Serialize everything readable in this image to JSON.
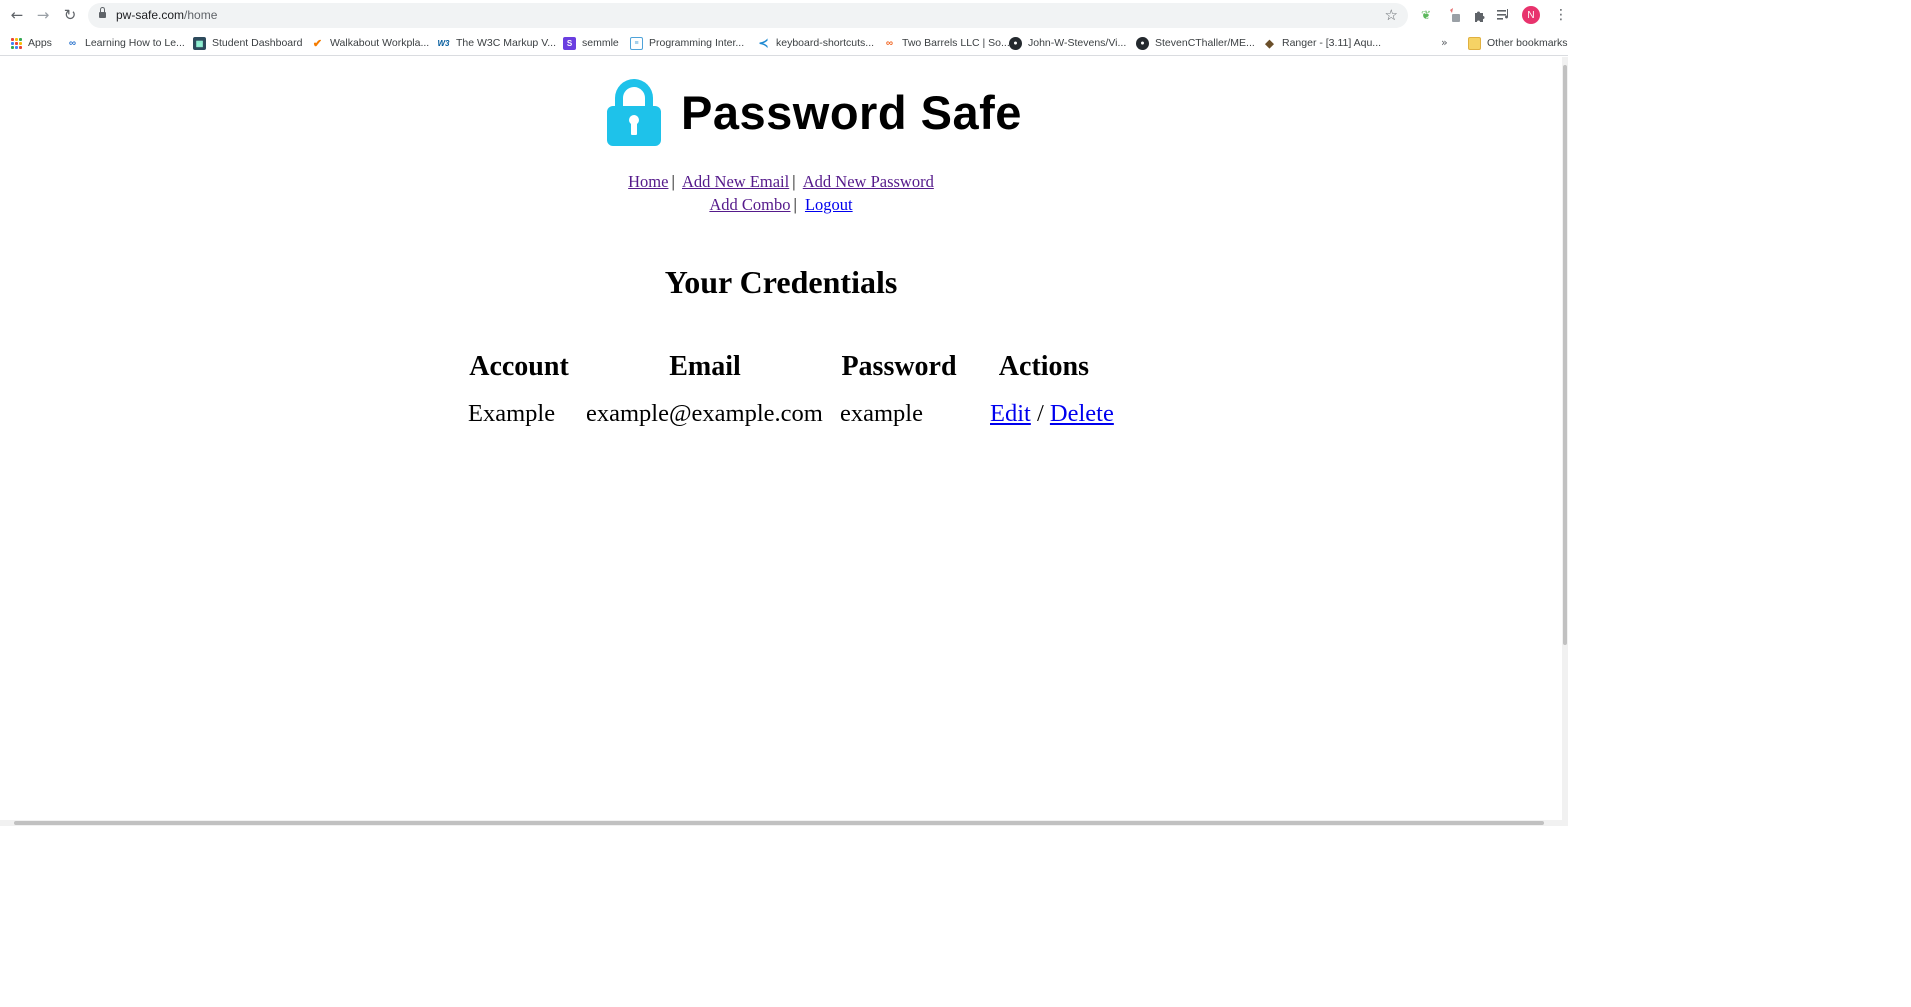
{
  "browser": {
    "url_host": "pw-safe.com",
    "url_path": "/home",
    "bookmarks": [
      {
        "label": "Apps",
        "icon": "apps-grid-icon"
      },
      {
        "label": "Learning How to Le...",
        "icon": "coursera-icon",
        "color": "#2a73cc"
      },
      {
        "label": "Student Dashboard",
        "icon": "dashboard-icon",
        "color": "#2d4a5c"
      },
      {
        "label": "Walkabout Workpla...",
        "icon": "walkabout-icon",
        "color": "#f57c00"
      },
      {
        "label": "The W3C Markup V...",
        "icon": "w3c-icon",
        "color": "#005a9c"
      },
      {
        "label": "semmle",
        "icon": "semmle-icon",
        "color": "#6a3ee0"
      },
      {
        "label": "Programming Inter...",
        "icon": "programming-icon",
        "color": "#4fa3d9"
      },
      {
        "label": "keyboard-shortcuts...",
        "icon": "vscode-icon",
        "color": "#1f8ad2"
      },
      {
        "label": "Two Barrels LLC | So...",
        "icon": "two-barrels-icon",
        "color": "#f16522"
      },
      {
        "label": "John-W-Stevens/Vi...",
        "icon": "github-icon",
        "color": "#24292e"
      },
      {
        "label": "StevenCThaller/ME...",
        "icon": "github-icon",
        "color": "#24292e"
      },
      {
        "label": "Ranger - [3.11] Aqu...",
        "icon": "ranger-icon",
        "color": "#6b4f2a"
      }
    ],
    "other_bookmarks": "Other bookmarks",
    "profile_initial": "N",
    "profile_color": "#e8336d"
  },
  "site": {
    "title": "Password Safe",
    "logo_color": "#1ec2ea",
    "nav": {
      "home": "Home",
      "add_email": "Add New Email",
      "add_password": "Add New Password",
      "add_combo": "Add Combo",
      "logout": "Logout",
      "separator": "|"
    },
    "heading": "Your Credentials",
    "table": {
      "headers": [
        "Account",
        "Email",
        "Password",
        "Actions"
      ],
      "rows": [
        {
          "account": "Example",
          "email": "example@example.com",
          "password": "example",
          "edit": "Edit",
          "slash": "/",
          "delete": "Delete"
        }
      ]
    }
  }
}
